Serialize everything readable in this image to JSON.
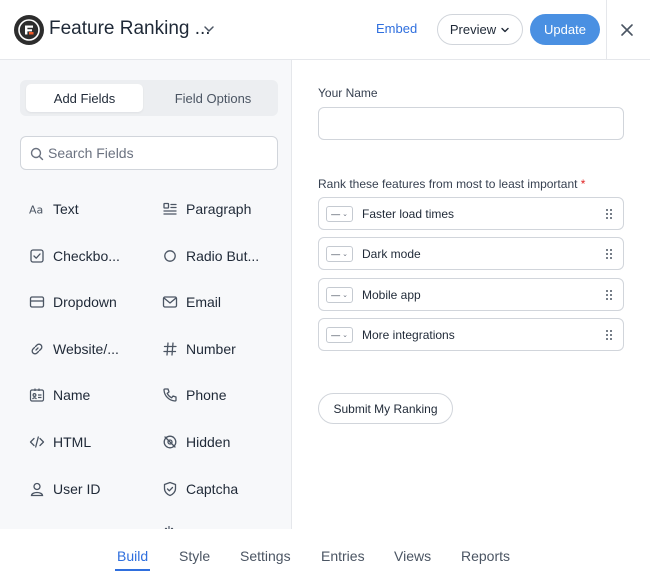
{
  "header": {
    "title": "Feature Ranking ...",
    "embed_label": "Embed",
    "preview_label": "Preview",
    "update_label": "Update",
    "brand_color": "#4a90e2"
  },
  "sidebar": {
    "tabs": [
      {
        "label": "Add Fields",
        "active": true
      },
      {
        "label": "Field Options",
        "active": false
      }
    ],
    "search_placeholder": "Search Fields",
    "fields": [
      {
        "label": "Text",
        "icon": "text-aa-icon"
      },
      {
        "label": "Paragraph",
        "icon": "paragraph-icon"
      },
      {
        "label": "Checkbo...",
        "icon": "checkbox-icon"
      },
      {
        "label": "Radio But...",
        "icon": "radio-icon"
      },
      {
        "label": "Dropdown",
        "icon": "dropdown-icon"
      },
      {
        "label": "Email",
        "icon": "envelope-icon"
      },
      {
        "label": "Website/...",
        "icon": "link-icon"
      },
      {
        "label": "Number",
        "icon": "hash-icon"
      },
      {
        "label": "Name",
        "icon": "id-card-icon"
      },
      {
        "label": "Phone",
        "icon": "phone-icon"
      },
      {
        "label": "HTML",
        "icon": "code-icon"
      },
      {
        "label": "Hidden",
        "icon": "eye-off-icon"
      },
      {
        "label": "User ID",
        "icon": "user-icon"
      },
      {
        "label": "Captcha",
        "icon": "shield-check-icon"
      }
    ]
  },
  "form": {
    "name_label": "Your Name",
    "name_value": "",
    "rank_label": "Rank these features from most to least important",
    "required_mark": "*",
    "rank_items": [
      {
        "label": "Faster load times",
        "select_value": "—"
      },
      {
        "label": "Dark mode",
        "select_value": "—"
      },
      {
        "label": "Mobile app",
        "select_value": "—"
      },
      {
        "label": "More integrations",
        "select_value": "—"
      }
    ],
    "submit_label": "Submit My Ranking"
  },
  "bottom_nav": {
    "items": [
      {
        "label": "Build",
        "active": true
      },
      {
        "label": "Style",
        "active": false
      },
      {
        "label": "Settings",
        "active": false
      },
      {
        "label": "Entries",
        "active": false
      },
      {
        "label": "Views",
        "active": false
      },
      {
        "label": "Reports",
        "active": false
      }
    ]
  }
}
